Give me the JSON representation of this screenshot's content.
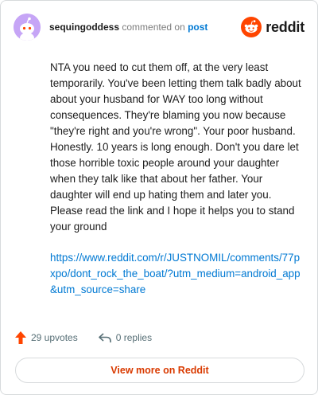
{
  "header": {
    "username": "sequingoddess",
    "commented_on_text": "commented on",
    "post_link_text": "post",
    "logo_text": "reddit"
  },
  "comment": {
    "paragraph": "NTA you need to cut them off, at the very least temporarily. You've been letting them talk badly about about your husband for WAY too long without consequences. They're blaming you now because \"they're right and you're wrong\". Your poor husband. Honestly. 10 years is long enough. Don't you dare let those horrible toxic people around your daughter when they talk like that about her father. Your daughter will end up hating them and later you. Please read the link and I hope it helps you to stand your ground",
    "link": "https://www.reddit.com/r/JUSTNOMIL/comments/77pxpo/dont_rock_the_boat/?utm_medium=android_app&utm_source=share"
  },
  "actions": {
    "upvotes": "29 upvotes",
    "replies": "0 replies"
  },
  "footer": {
    "view_more_label": "View more on Reddit"
  },
  "colors": {
    "accent_orange": "#ff4500",
    "link_blue": "#0079d3",
    "button_text": "#d93a00",
    "avatar_bg": "#c6a5f6"
  },
  "icons": {
    "avatar": "snoo-avatar",
    "logo": "reddit-logo-icon",
    "upvote": "upvote-arrow-icon",
    "reply": "reply-arrow-icon"
  }
}
